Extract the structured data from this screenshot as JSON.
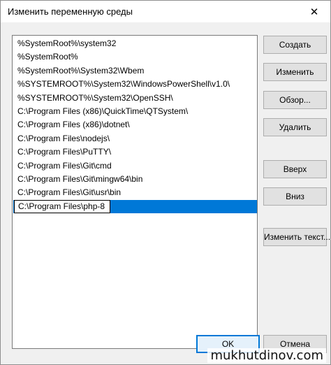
{
  "window": {
    "title": "Изменить переменную среды",
    "close_glyph": "✕"
  },
  "list": {
    "items": [
      "%SystemRoot%\\system32",
      "%SystemRoot%",
      "%SystemRoot%\\System32\\Wbem",
      "%SYSTEMROOT%\\System32\\WindowsPowerShell\\v1.0\\",
      "%SYSTEMROOT%\\System32\\OpenSSH\\",
      "C:\\Program Files (x86)\\QuickTime\\QTSystem\\",
      "C:\\Program Files (x86)\\dotnet\\",
      "C:\\Program Files\\nodejs\\",
      "C:\\Program Files\\PuTTY\\",
      "C:\\Program Files\\Git\\cmd",
      "C:\\Program Files\\Git\\mingw64\\bin",
      "C:\\Program Files\\Git\\usr\\bin"
    ],
    "editing_value": "C:\\Program Files\\php-8"
  },
  "buttons": {
    "create": "Создать",
    "edit": "Изменить",
    "browse": "Обзор...",
    "delete": "Удалить",
    "up": "Вверх",
    "down": "Вниз",
    "edit_text": "Изменить текст...",
    "ok": "OK",
    "cancel": "Отмена"
  },
  "watermark": "mukhutdinov.com",
  "colors": {
    "selection": "#0078d7",
    "dialog_bg": "#f0f0f0"
  }
}
